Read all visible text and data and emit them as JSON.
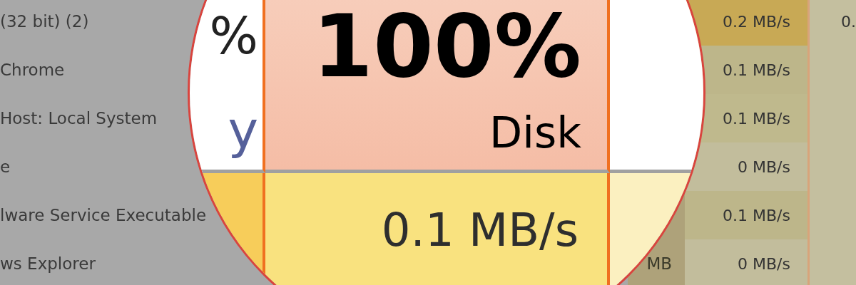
{
  "processes": [
    {
      "name": "(32 bit) (2)",
      "disk": "0.2 MB/s",
      "network": "0.",
      "color": "#c8a955"
    },
    {
      "name": "Chrome",
      "disk": "0.1 MB/s",
      "color": "#bdb68a"
    },
    {
      "name": "Host: Local System",
      "disk": "0.1 MB/s",
      "color": "#bfb98d"
    },
    {
      "name": "e",
      "disk": "0 MB/s",
      "color": "#c2bd9c"
    },
    {
      "name": "lware Service Executable",
      "disk": "0.1 MB/s",
      "color": "#bdb68a"
    },
    {
      "name": "ws Explorer",
      "memory": "MB",
      "disk": "0 MB/s",
      "color": "#c2bd9c"
    }
  ],
  "magnifier": {
    "memory_glyphs": [
      "%",
      "y"
    ],
    "disk_percent": "100%",
    "disk_label": "Disk",
    "disk_rate": "0.1 MB/s"
  }
}
